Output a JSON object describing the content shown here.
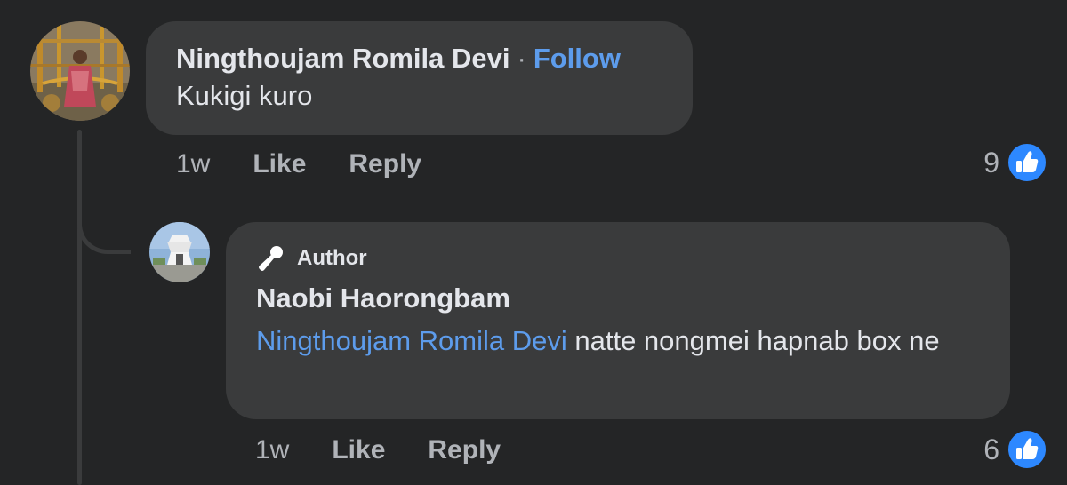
{
  "colors": {
    "background": "#242526",
    "bubble": "#3a3b3c",
    "link": "#5d9cec",
    "secondary_text": "#b0b3b8",
    "like_blue": "#2d88ff"
  },
  "comment": {
    "author": "Ningthoujam Romila Devi",
    "separator": "·",
    "follow_label": "Follow",
    "text": "Kukigi kuro",
    "time": "1w",
    "like_label": "Like",
    "reply_label": "Reply",
    "reaction_count": "9",
    "reaction_icon": "like-thumbs-up-icon"
  },
  "reply": {
    "badge_icon": "microphone-icon",
    "badge_label": "Author",
    "author": "Naobi Haorongbam",
    "mention": "Ningthoujam Romila Devi",
    "text": " natte nongmei hapnab box ne",
    "time": "1w",
    "like_label": "Like",
    "reply_label": "Reply",
    "reaction_count": "6",
    "reaction_icon": "like-thumbs-up-icon"
  }
}
